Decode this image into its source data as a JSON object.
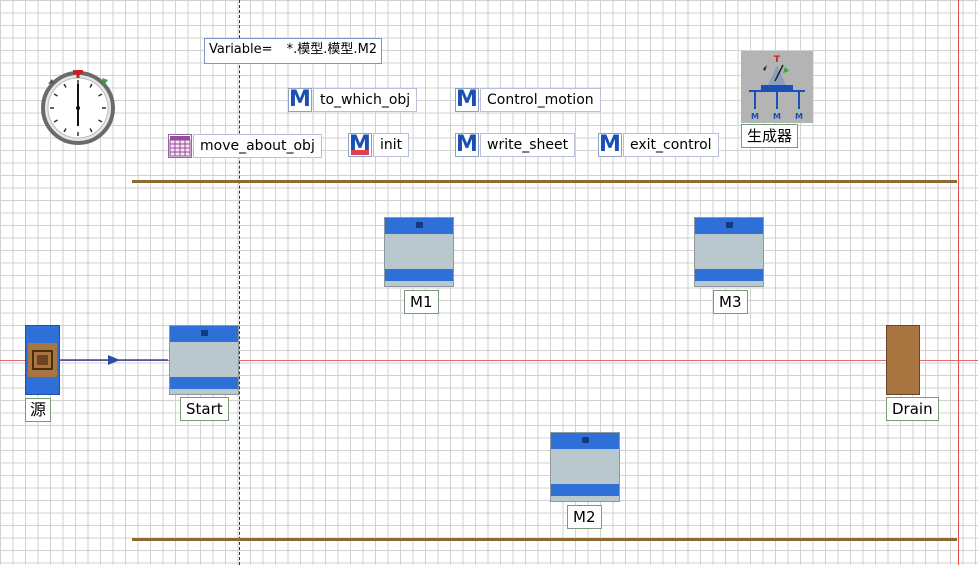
{
  "variable": {
    "label": "Variable=",
    "value": "*.模型.模型.M2"
  },
  "methods": [
    {
      "name": "to_which_obj"
    },
    {
      "name": "Control_motion"
    },
    {
      "name": "init"
    },
    {
      "name": "write_sheet"
    },
    {
      "name": "exit_control"
    }
  ],
  "table_object": {
    "name": "move_about_obj"
  },
  "generator": {
    "name": "生成器"
  },
  "source": {
    "name": "源"
  },
  "stations": {
    "start": "Start",
    "m1": "M1",
    "m2": "M2",
    "m3": "M3"
  },
  "drain": {
    "name": "Drain"
  },
  "icons": [
    "clock-icon",
    "generator-icon",
    "table-icon",
    "method-icon",
    "source-icon",
    "drain-icon",
    "connector-arrow-icon"
  ],
  "colors": {
    "grid": "#d2d2d2",
    "rail": "#8a6a2e",
    "machine_body": "#b8c8cc",
    "machine_band": "#2f70d8",
    "method_m": "#1a4fb5",
    "drain": "#a87540",
    "source": "#a87540"
  }
}
